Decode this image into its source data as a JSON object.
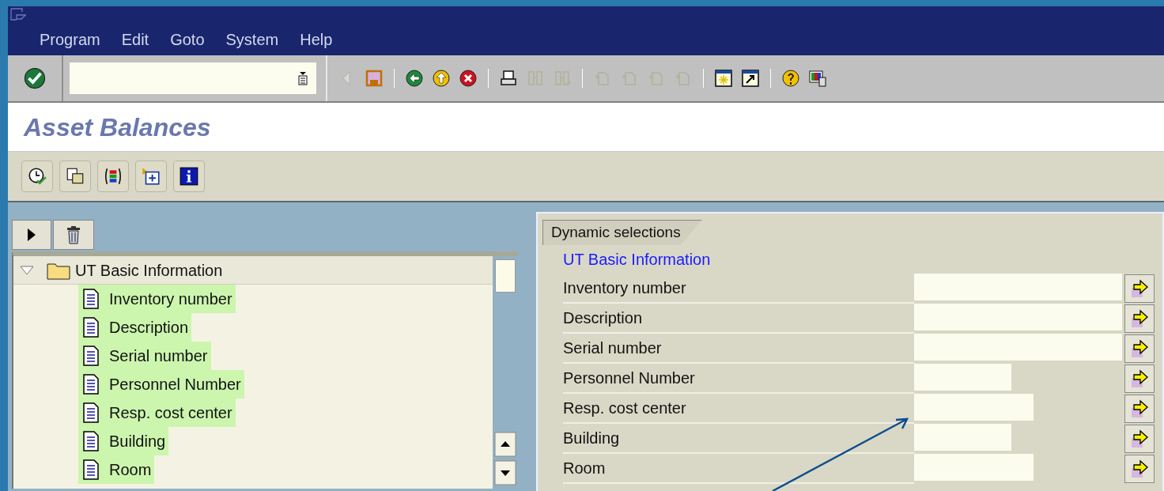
{
  "menu": [
    {
      "label": "Program"
    },
    {
      "label": "Edit"
    },
    {
      "label": "Goto"
    },
    {
      "label": "System"
    },
    {
      "label": "Help"
    }
  ],
  "toolbar": {
    "buttons": [
      {
        "kind": "back",
        "disabled": true
      },
      {
        "kind": "save",
        "disabled": false
      },
      {
        "kind": "sep"
      },
      {
        "kind": "green",
        "disabled": false
      },
      {
        "kind": "yellow",
        "disabled": false
      },
      {
        "kind": "red",
        "disabled": false
      },
      {
        "kind": "sep"
      },
      {
        "kind": "print",
        "disabled": false
      },
      {
        "kind": "find",
        "disabled": true
      },
      {
        "kind": "findnext",
        "disabled": true
      },
      {
        "kind": "sep"
      },
      {
        "kind": "page",
        "disabled": true
      },
      {
        "kind": "page",
        "disabled": true
      },
      {
        "kind": "page",
        "disabled": true
      },
      {
        "kind": "page",
        "disabled": true
      },
      {
        "kind": "sep"
      },
      {
        "kind": "newwin",
        "disabled": false
      },
      {
        "kind": "shortcut",
        "disabled": false
      },
      {
        "kind": "sep"
      },
      {
        "kind": "help",
        "disabled": false
      },
      {
        "kind": "layout",
        "disabled": false
      }
    ]
  },
  "title": "Asset Balances",
  "app_toolbar": [
    {
      "kind": "execute"
    },
    {
      "kind": "copy"
    },
    {
      "kind": "colors"
    },
    {
      "kind": "add"
    },
    {
      "kind": "info"
    }
  ],
  "tree": {
    "label": "UT Basic Information",
    "expanded": true,
    "children": [
      {
        "label": "Inventory number",
        "highlighted": true
      },
      {
        "label": "Description",
        "highlighted": true
      },
      {
        "label": "Serial number",
        "highlighted": true
      },
      {
        "label": "Personnel Number",
        "highlighted": true
      },
      {
        "label": "Resp. cost center",
        "highlighted": true
      },
      {
        "label": "Building",
        "highlighted": true
      },
      {
        "label": "Room",
        "highlighted": true
      }
    ]
  },
  "selections": {
    "tab": "Dynamic selections",
    "group": "UT Basic Information",
    "fields": [
      {
        "label": "Inventory number",
        "kind": "long"
      },
      {
        "label": "Description",
        "kind": "long"
      },
      {
        "label": "Serial number",
        "kind": "long"
      },
      {
        "label": "Personnel Number",
        "kind": "short"
      },
      {
        "label": "Resp. cost center",
        "kind": "medium"
      },
      {
        "label": "Building",
        "kind": "short"
      },
      {
        "label": "Room",
        "kind": "medium"
      }
    ]
  }
}
